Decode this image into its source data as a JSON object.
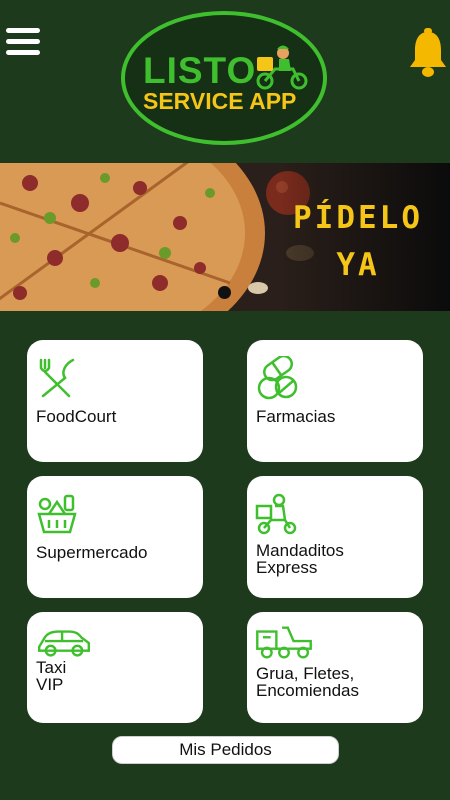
{
  "logo": {
    "line1": "LISTO",
    "line2": "SERVICE APP"
  },
  "banner": {
    "line1": "PÍDELO",
    "line2": "YA"
  },
  "icons": {
    "menu": "hamburger-menu-icon",
    "notifications": "bell-icon"
  },
  "categories": [
    {
      "label": "FoodCourt",
      "icon": "fork-knife-icon"
    },
    {
      "label": "Farmacias",
      "icon": "pills-icon"
    },
    {
      "label": "Supermercado",
      "icon": "grocery-basket-icon"
    },
    {
      "label": "Mandaditos\nExpress",
      "icon": "delivery-scooter-icon"
    },
    {
      "label": "Taxi\nVIP",
      "icon": "car-icon"
    },
    {
      "label": "Grua, Fletes,\nEncomiendas",
      "icon": "tow-truck-icon"
    }
  ],
  "footer": {
    "orders_button": "Mis Pedidos"
  },
  "colors": {
    "background": "#1e3a1d",
    "accent_green": "#3fbf2e",
    "accent_yellow": "#f5c518",
    "card": "#ffffff"
  }
}
